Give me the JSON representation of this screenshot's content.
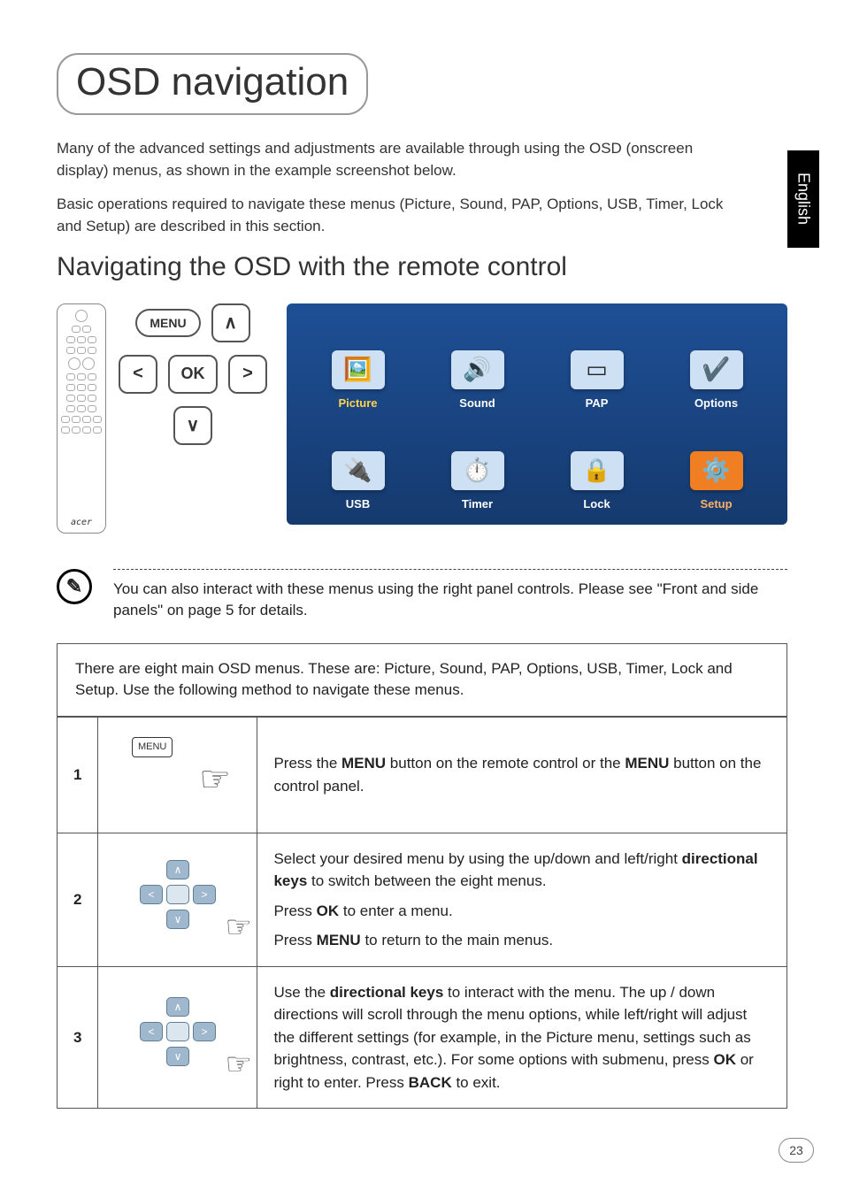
{
  "sideTab": "English",
  "pageNumber": "23",
  "title": "OSD navigation",
  "intro1": "Many of the advanced settings and adjustments are available through using the OSD (onscreen display) menus, as shown in the example screenshot below.",
  "intro2": "Basic operations required to navigate these menus (Picture, Sound, PAP, Options, USB, Timer, Lock and Setup) are described in this section.",
  "subtitle": "Navigating the OSD with the remote control",
  "remote": {
    "menuKey": "MENU",
    "okKey": "OK",
    "up": "∧",
    "down": "∨",
    "left": "<",
    "right": ">",
    "brand": "acer"
  },
  "osd": {
    "tiles": [
      {
        "label": "Picture",
        "glyph": "🖼️",
        "sel": true
      },
      {
        "label": "Sound",
        "glyph": "🔊"
      },
      {
        "label": "PAP",
        "glyph": "▭"
      },
      {
        "label": "Options",
        "glyph": "✔️"
      },
      {
        "label": "USB",
        "glyph": "🔌"
      },
      {
        "label": "Timer",
        "glyph": "⏱️"
      },
      {
        "label": "Lock",
        "glyph": "🔒"
      },
      {
        "label": "Setup",
        "glyph": "⚙️",
        "orange": true
      }
    ]
  },
  "note": "You can also interact with these menus using the right panel controls. Please see \"Front and side panels\" on page 5 for details.",
  "stepsIntro": "There are eight main OSD menus. These are: Picture, Sound, PAP, Options, USB, Timer, Lock and Setup. Use the following method to navigate these menus.",
  "steps": [
    {
      "n": "1",
      "graphic": "menu",
      "paras": [
        [
          {
            "t": "Press the "
          },
          {
            "t": "MENU",
            "b": true
          },
          {
            "t": " button on the remote control or the "
          },
          {
            "t": "MENU",
            "b": true
          },
          {
            "t": " button on the control panel."
          }
        ]
      ]
    },
    {
      "n": "2",
      "graphic": "dpad-ok",
      "paras": [
        [
          {
            "t": "Select your desired menu by using the up/down and left/right "
          },
          {
            "t": "directional keys",
            "b": true
          },
          {
            "t": " to switch between the eight menus."
          }
        ],
        [
          {
            "t": "Press "
          },
          {
            "t": "OK",
            "b": true
          },
          {
            "t": " to enter a menu."
          }
        ],
        [
          {
            "t": "Press "
          },
          {
            "t": "MENU",
            "b": true
          },
          {
            "t": " to return to the main menus."
          }
        ]
      ]
    },
    {
      "n": "3",
      "graphic": "dpad",
      "paras": [
        [
          {
            "t": "Use the "
          },
          {
            "t": "directional keys",
            "b": true
          },
          {
            "t": " to interact with the menu. The up / down directions will scroll through the menu options, while left/right will adjust the different settings (for example, in the Picture menu, settings such as brightness, contrast, etc.). For some options with submenu, press "
          },
          {
            "t": "OK",
            "b": true
          },
          {
            "t": " or right to enter. Press "
          },
          {
            "t": "BACK",
            "b": true
          },
          {
            "t": " to exit."
          }
        ]
      ]
    }
  ]
}
